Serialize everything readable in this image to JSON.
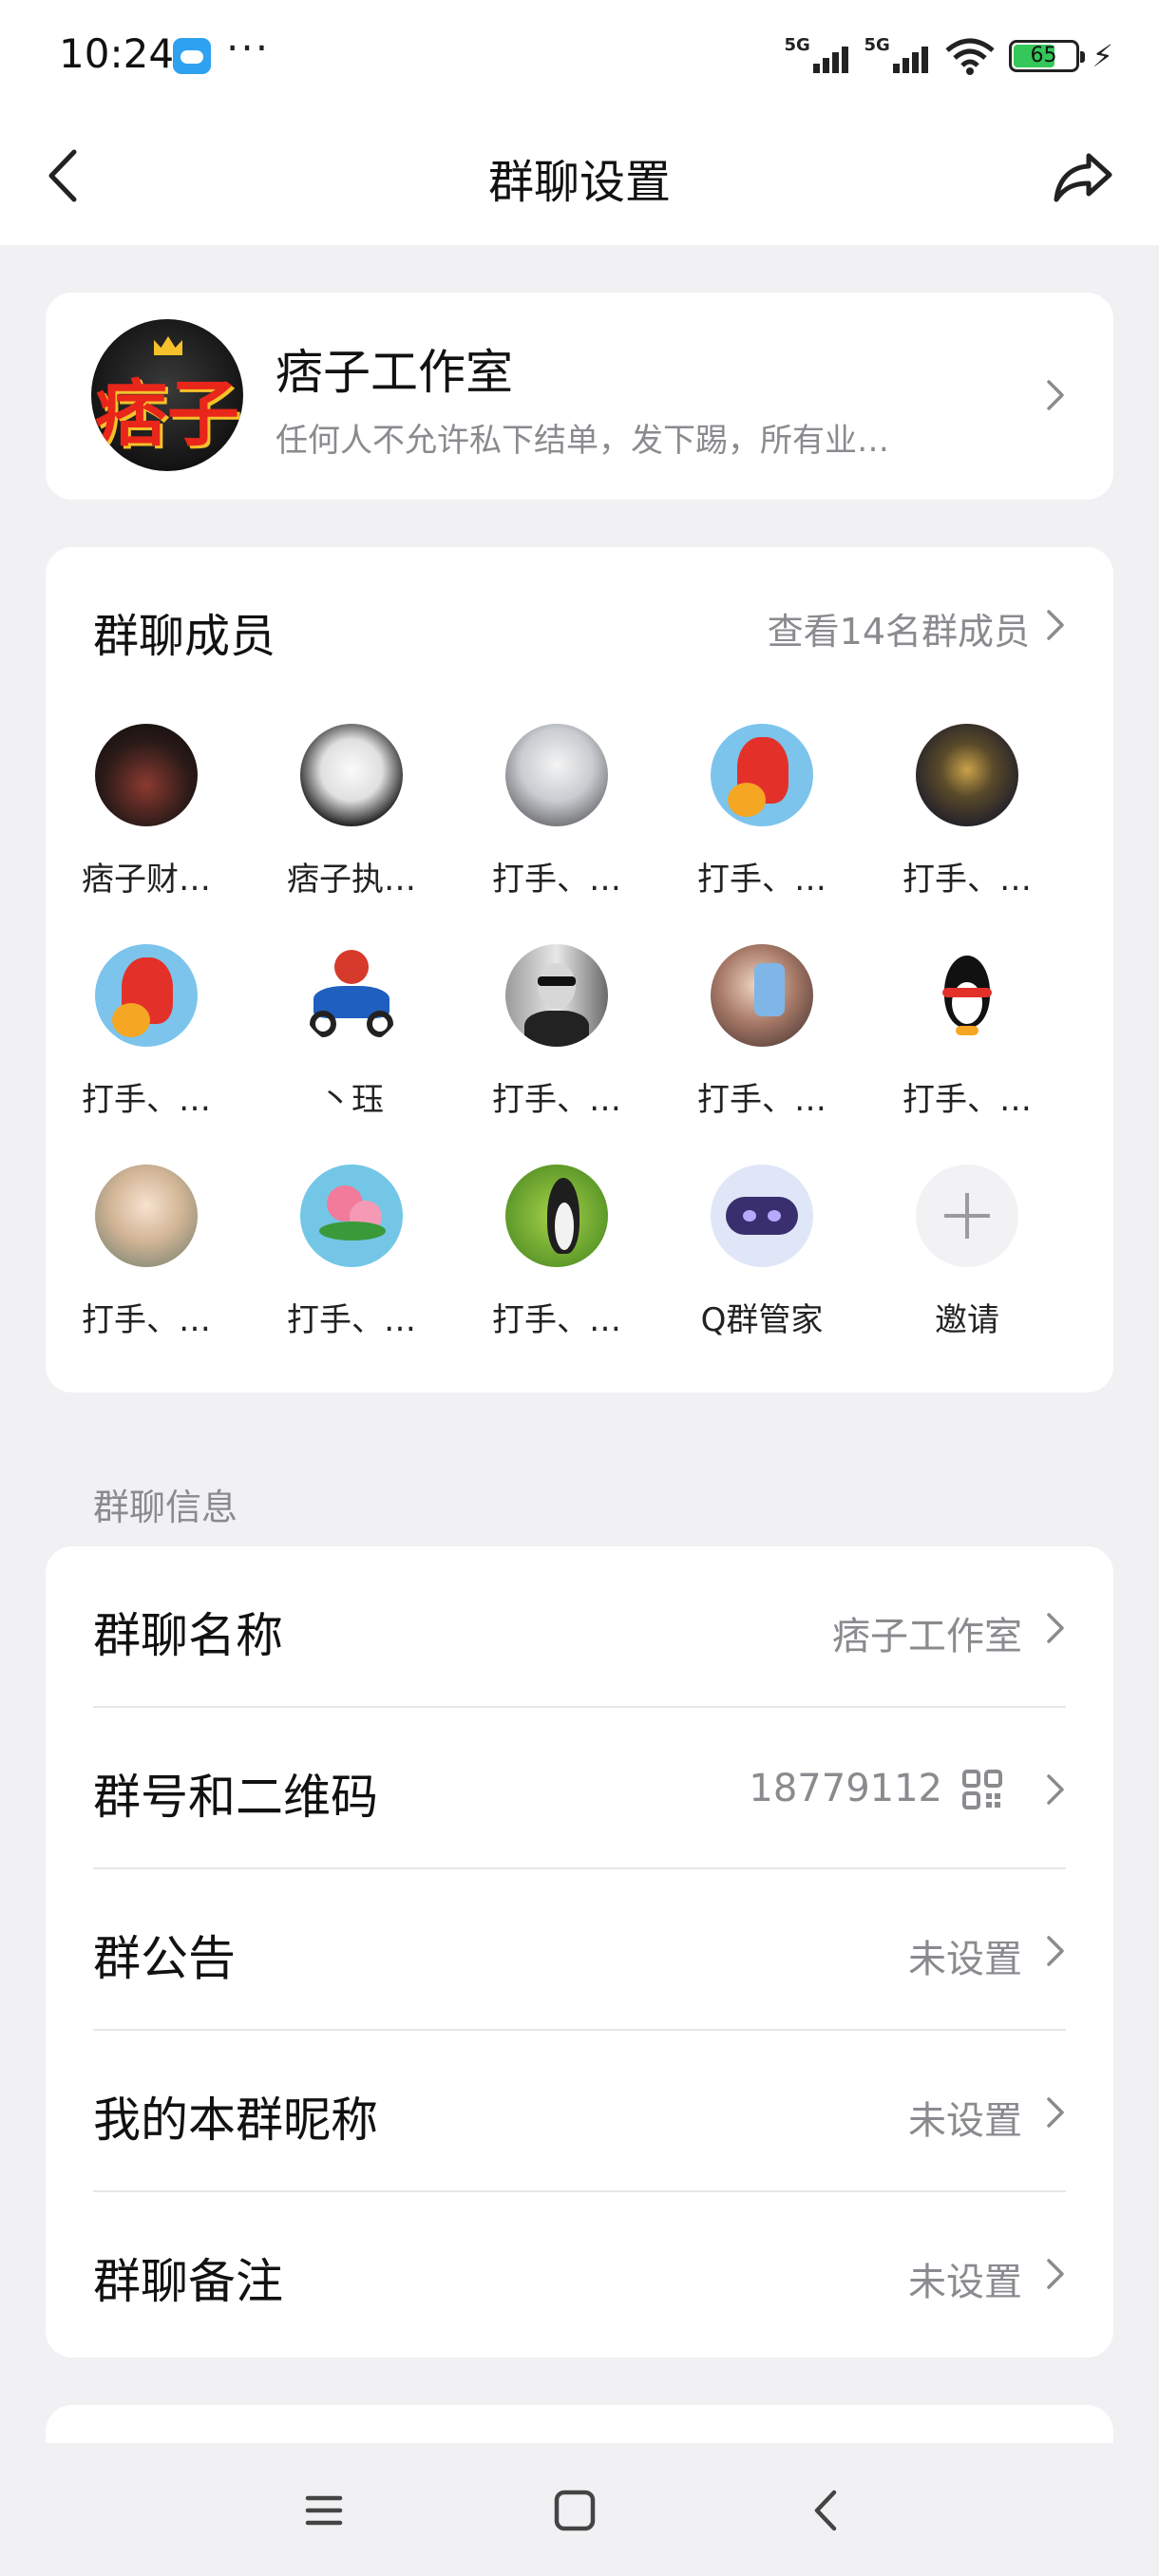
{
  "status_bar": {
    "time": "10:24",
    "more": "···",
    "signal1_label": "5G",
    "signal2_label": "5G",
    "battery_level": "65"
  },
  "nav": {
    "title": "群聊设置"
  },
  "group": {
    "avatar_text": "痞子",
    "name": "痞子工作室",
    "description": "任何人不允许私下结单，发下踢，所有业…"
  },
  "members": {
    "title": "群聊成员",
    "view_all": "查看14名群成员",
    "items": [
      {
        "name": "痞子财…",
        "avatar": "dark-photo"
      },
      {
        "name": "痞子执…",
        "avatar": "anime-bw"
      },
      {
        "name": "打手、…",
        "avatar": "anime-white-hair"
      },
      {
        "name": "打手、…",
        "avatar": "red-cartoon"
      },
      {
        "name": "打手、…",
        "avatar": "game-character"
      },
      {
        "name": "打手、…",
        "avatar": "red-cartoon"
      },
      {
        "name": "丶珏",
        "avatar": "motorcycle"
      },
      {
        "name": "打手、…",
        "avatar": "man-sunglasses"
      },
      {
        "name": "打手、…",
        "avatar": "girl-phone"
      },
      {
        "name": "打手、…",
        "avatar": "qq-penguin"
      },
      {
        "name": "打手、…",
        "avatar": "girl-blonde"
      },
      {
        "name": "打手、…",
        "avatar": "flowers"
      },
      {
        "name": "打手、…",
        "avatar": "penguin-photo"
      },
      {
        "name": "Q群管家",
        "avatar": "robot"
      },
      {
        "name": "邀请",
        "avatar": "invite-plus"
      }
    ]
  },
  "info_section": {
    "label": "群聊信息",
    "rows": [
      {
        "label": "群聊名称",
        "value": "痞子工作室"
      },
      {
        "label": "群号和二维码",
        "value": "18779112"
      },
      {
        "label": "群公告",
        "value": "未设置"
      },
      {
        "label": "我的本群昵称",
        "value": "未设置"
      },
      {
        "label": "群聊备注",
        "value": "未设置"
      }
    ]
  },
  "colors": {
    "background": "#f1f1f4",
    "card": "#ffffff",
    "secondary_text": "#8a8a8f",
    "battery_green": "#34c759"
  }
}
